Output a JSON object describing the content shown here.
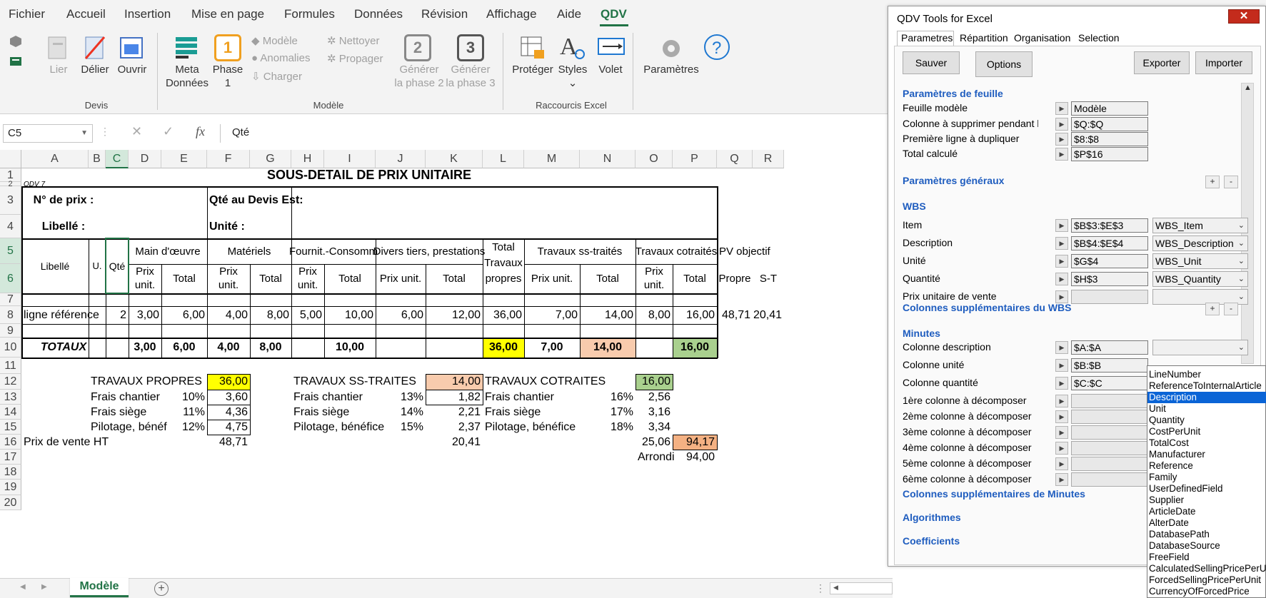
{
  "menu": [
    "Fichier",
    "Accueil",
    "Insertion",
    "Mise en page",
    "Formules",
    "Données",
    "Révision",
    "Affichage",
    "Aide",
    "QDV"
  ],
  "ribbon": {
    "devis": {
      "group": "Devis",
      "lier": "Lier",
      "delier": "Délier",
      "ouvrir": "Ouvrir"
    },
    "modele": {
      "group": "Modèle",
      "meta1": "Meta",
      "meta2": "Données",
      "phase_num": "1",
      "phase1": "Phase",
      "phase2": "1",
      "modele_small": "Modèle",
      "anomalies": "Anomalies",
      "charger": "Charger",
      "nettoyer": "Nettoyer",
      "propager": "Propager",
      "gen2_num": "2",
      "gen3_num": "3",
      "gen_a": "Générer",
      "gen2_b": "la phase 2",
      "gen3_b": "la phase 3"
    },
    "raccourcis": {
      "group": "Raccourcis Excel",
      "proteger": "Protéger",
      "styles": "Styles",
      "volet": "Volet"
    },
    "params": "Paramètres"
  },
  "formula": {
    "namebox": "C5",
    "fx": "fx",
    "value": "Qté"
  },
  "sheet": {
    "cols": [
      "A",
      "B",
      "C",
      "D",
      "E",
      "F",
      "G",
      "H",
      "I",
      "J",
      "K",
      "L",
      "M",
      "N",
      "O",
      "P",
      "Q",
      "R"
    ],
    "rows": [
      "1",
      "2",
      "3",
      "4",
      "5",
      "6",
      "7",
      "8",
      "9",
      "10",
      "11",
      "12",
      "13",
      "14",
      "15",
      "16",
      "17",
      "18",
      "19",
      "20"
    ],
    "title": "SOUS-DETAIL DE PRIX UNITAIRE",
    "qdv": "QDV 7",
    "nprix": "N° de prix :",
    "qte_devis": "Qté au Devis Est:",
    "libelle_lbl": "Libellé :",
    "unite_lbl": "Unité :",
    "h_libelle": "Libellé",
    "h_u": "U.",
    "h_qte": "Qté",
    "h_mo": "Main d'œuvre",
    "h_mat": "Matériels",
    "h_fourn": "Fournit.-Consomm",
    "h_divers": "Divers tiers, prestations",
    "h_total1": "Total",
    "h_total2": "Travaux",
    "h_total3": "propres",
    "h_sst": "Travaux ss-traités",
    "h_cot": "Travaux cotraités",
    "h_pv": "PV objectif",
    "h_prix1": "Prix",
    "h_prix2": "unit.",
    "h_totalc": "Total",
    "h_prixunit": "Prix unit.",
    "h_propre": "Propre",
    "h_st": "S-T",
    "r8": {
      "a": "ligne référence",
      "c": "2",
      "d": "3,00",
      "e": "6,00",
      "f": "4,00",
      "g": "8,00",
      "h": "5,00",
      "i": "10,00",
      "j": "6,00",
      "k": "12,00",
      "l": "36,00",
      "m": "7,00",
      "n": "14,00",
      "o": "8,00",
      "p": "16,00",
      "q": "48,71",
      "r": "20,41"
    },
    "r10": {
      "a": "TOTAUX",
      "d": "3,00",
      "e": "6,00",
      "f": "4,00",
      "g": "8,00",
      "i": "10,00",
      "l": "36,00",
      "m": "7,00",
      "n": "14,00",
      "p": "16,00"
    },
    "tp": {
      "label": "TRAVAUX PROPRES",
      "val": "36,00",
      "fc": "Frais chantier",
      "fc_p": "10%",
      "fc_v": "3,60",
      "fs": "Frais siège",
      "fs_p": "11%",
      "fs_v": "4,36",
      "pb": "Pilotage, bénéf",
      "pb_p": "12%",
      "pb_v": "4,75"
    },
    "ts": {
      "label": "TRAVAUX SS-TRAITES",
      "val": "14,00",
      "fc": "Frais chantier",
      "fc_p": "13%",
      "fc_v": "1,82",
      "fs": "Frais siège",
      "fs_p": "14%",
      "fs_v": "2,21",
      "pb": "Pilotage, bénéfice",
      "pb_p": "15%",
      "pb_v": "2,37"
    },
    "tc": {
      "label": "TRAVAUX COTRAITES",
      "val": "16,00",
      "fc": "Frais chantier",
      "fc_p": "16%",
      "fc_v": "2,56",
      "fs": "Frais siège",
      "fs_p": "17%",
      "fs_v": "3,16",
      "pb": "Pilotage, bénéfice",
      "pb_p": "18%",
      "pb_v": "3,34"
    },
    "pv": {
      "label": "Prix de vente HT",
      "f": "48,71",
      "k": "20,41",
      "o": "25,06",
      "p": "94,17",
      "arrondi": "Arrondi",
      "arr_v": "94,00"
    },
    "colors": {
      "yellow": "#ffff00",
      "peach": "#f8cbad",
      "green": "#a9d08e",
      "orange": "#f4b183"
    }
  },
  "tabs": {
    "active": "Modèle"
  },
  "panel": {
    "title": "QDV Tools for Excel",
    "tabs": [
      "Parametres",
      "Répartition",
      "Organisation",
      "Selection"
    ],
    "buttons": {
      "save": "Sauver",
      "options": "Options",
      "export": "Exporter",
      "import": "Importer"
    },
    "sec_feuille": "Paramètres de feuille",
    "feuille": [
      {
        "label": "Feuille modèle",
        "value": "Modèle"
      },
      {
        "label": "Colonne à supprimer pendant la co",
        "value": "$Q:$Q"
      },
      {
        "label": "Première ligne à dupliquer",
        "value": "$8:$8"
      },
      {
        "label": "Total calculé",
        "value": "$P$16"
      }
    ],
    "sec_gen": "Paramètres généraux",
    "sec_wbs": "WBS",
    "wbs": [
      {
        "label": "Item",
        "value": "$B$3:$E$3",
        "sel": "WBS_Item"
      },
      {
        "label": "Description",
        "value": "$B$4:$E$4",
        "sel": "WBS_Description"
      },
      {
        "label": "Unité",
        "value": "$G$4",
        "sel": "WBS_Unit"
      },
      {
        "label": "Quantité",
        "value": "$H$3",
        "sel": "WBS_Quantity"
      },
      {
        "label": "Prix unitaire de vente",
        "value": "",
        "sel": ""
      }
    ],
    "sec_wbs_sup": "Colonnes supplémentaires du WBS",
    "sec_min": "Minutes",
    "minutes": [
      {
        "label": "Colonne description",
        "value": "$A:$A"
      },
      {
        "label": "Colonne unité",
        "value": "$B:$B"
      },
      {
        "label": "Colonne quantité",
        "value": "$C:$C"
      }
    ],
    "decomp": [
      "1ère colonne à décomposer",
      "2ème colonne à décomposer",
      "3ème colonne à décomposer",
      "4ème colonne à décomposer",
      "5ème colonne à décomposer",
      "6ème colonne à décomposer"
    ],
    "sec_min_sup": "Colonnes supplémentaires de Minutes",
    "sec_algo": "Algorithmes",
    "sec_coef": "Coefficients",
    "dropdown": [
      "LineNumber",
      "ReferenceToInternalArticle",
      "Description",
      "Unit",
      "Quantity",
      "CostPerUnit",
      "TotalCost",
      "Manufacturer",
      "Reference",
      "Family",
      "UserDefinedField",
      "Supplier",
      "ArticleDate",
      "AlterDate",
      "DatabasePath",
      "DatabaseSource",
      "FreeField",
      "CalculatedSellingPricePerUnit",
      "ForcedSellingPricePerUnit",
      "CurrencyOfForcedPrice"
    ],
    "dropdown_selected": "Description"
  }
}
